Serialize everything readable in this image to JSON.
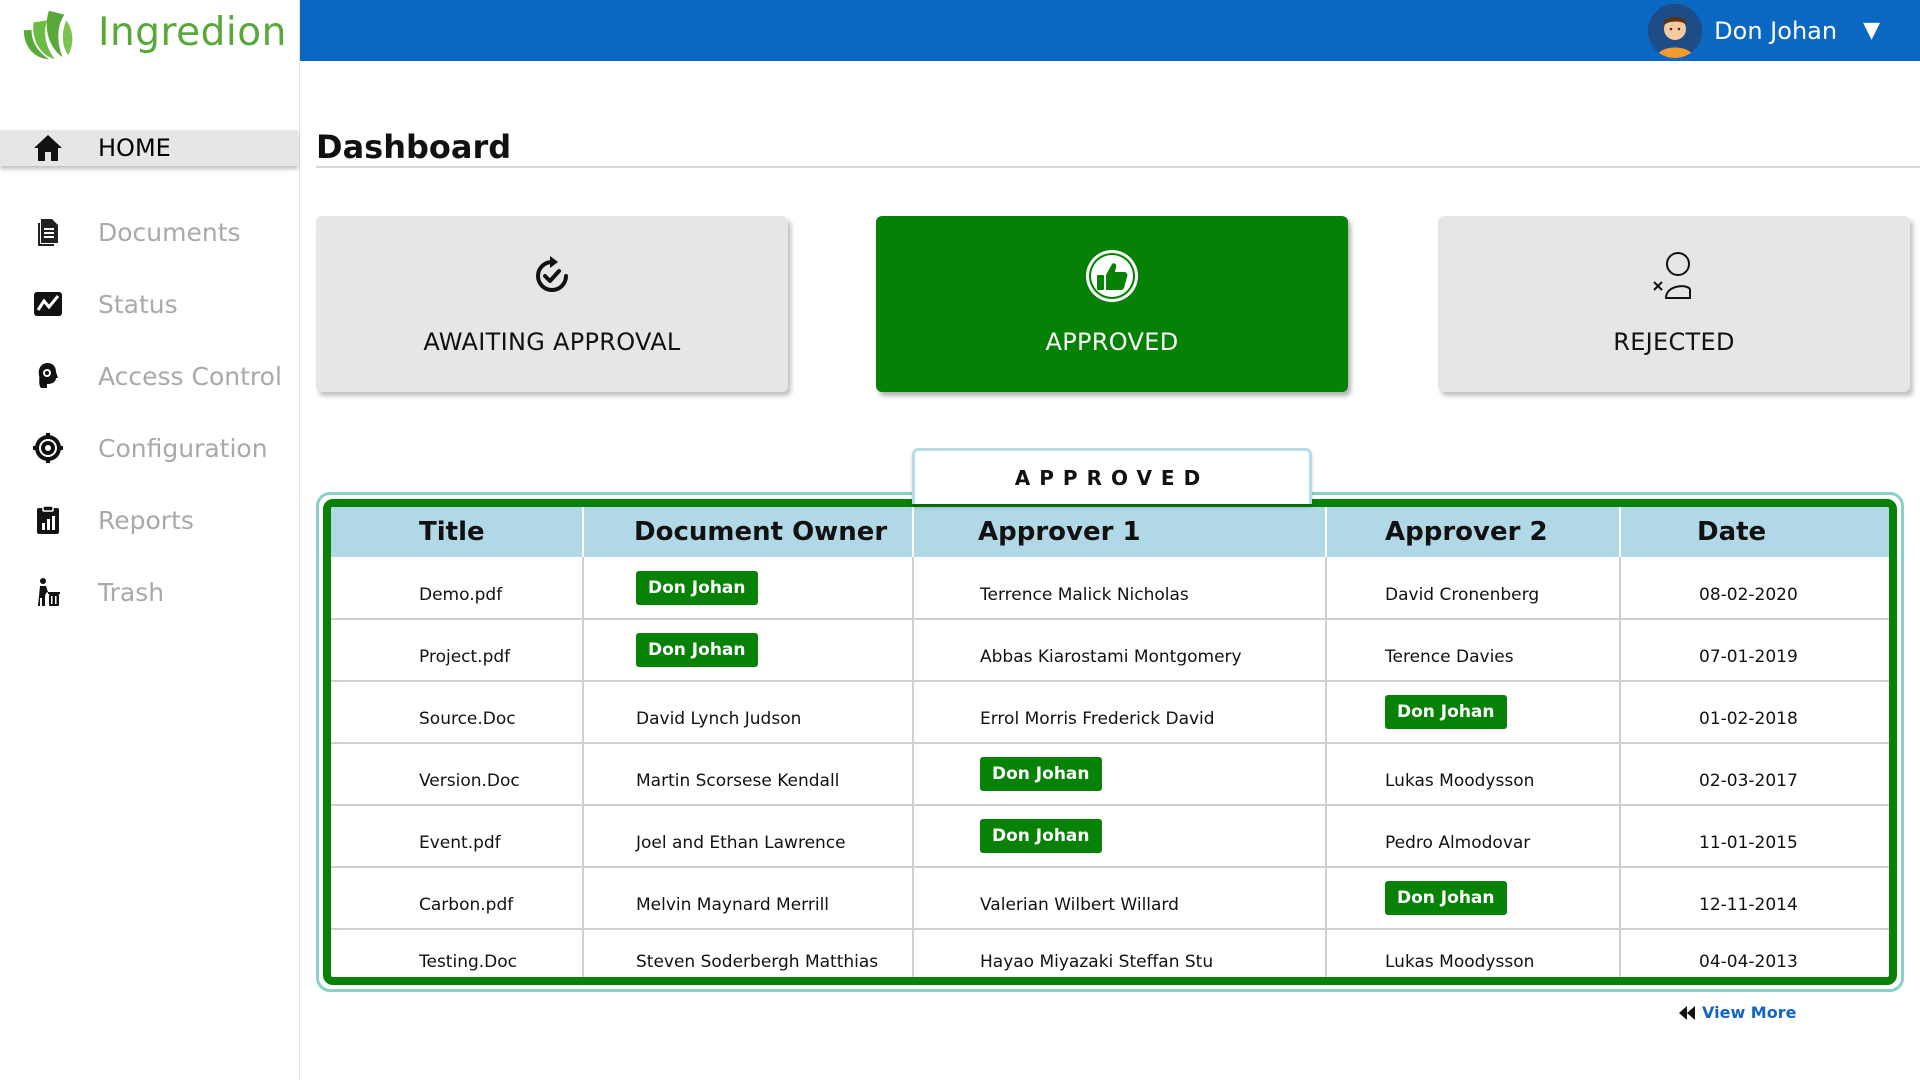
{
  "brand": {
    "name": "Ingredion",
    "color": "#59a93a"
  },
  "topbar": {
    "user_name": "Don Johan",
    "color": "#0a68c3"
  },
  "sidebar": {
    "items": [
      {
        "label": "HOME",
        "icon": "home-icon",
        "active": true
      },
      {
        "label": "Documents",
        "icon": "documents-icon"
      },
      {
        "label": "Status",
        "icon": "status-chart-icon"
      },
      {
        "label": "Access Control",
        "icon": "access-control-icon"
      },
      {
        "label": "Configuration",
        "icon": "configuration-icon"
      },
      {
        "label": "Reports",
        "icon": "reports-icon"
      },
      {
        "label": "Trash",
        "icon": "trash-icon"
      }
    ]
  },
  "main": {
    "title": "Dashboard",
    "cards": [
      {
        "label": "AWAITING APPROVAL",
        "icon": "refresh-check-icon"
      },
      {
        "label": "APPROVED",
        "icon": "thumbs-up-icon",
        "selected": true
      },
      {
        "label": "REJECTED",
        "icon": "user-reject-icon"
      }
    ],
    "table": {
      "section_label": "APPROVED",
      "columns": [
        "Title",
        "Document Owner",
        "Approver 1",
        "Approver 2",
        "Date"
      ],
      "rows": [
        [
          "Demo.pdf",
          "Don Johan",
          "Terrence Malick Nicholas",
          "David Cronenberg",
          "08-02-2020"
        ],
        [
          "Project.pdf",
          "Don Johan",
          "Abbas Kiarostami Montgomery",
          "Terence Davies",
          "07-01-2019"
        ],
        [
          "Source.Doc",
          "David Lynch Judson",
          "Errol Morris Frederick David",
          "Don Johan",
          "01-02-2018"
        ],
        [
          "Version.Doc",
          "Martin Scorsese Kendall",
          "Don Johan",
          "Lukas Moodysson",
          "02-03-2017"
        ],
        [
          "Event.pdf",
          "Joel and Ethan Lawrence",
          "Don Johan",
          "Pedro Almodovar",
          "11-01-2015"
        ],
        [
          "Carbon.pdf",
          "Melvin Maynard  Merrill",
          "Valerian Wilbert Willard",
          "Don Johan",
          "12-11-2014"
        ],
        [
          "Testing.Doc",
          "Steven Soderbergh Matthias",
          "Hayao Miyazaki Steffan Stu",
          "Lukas Moodysson",
          "04-04-2013"
        ]
      ],
      "highlight_name": "Don Johan",
      "accent": "#078207",
      "header_bg": "#b1d8e6"
    },
    "view_more": "View More"
  }
}
